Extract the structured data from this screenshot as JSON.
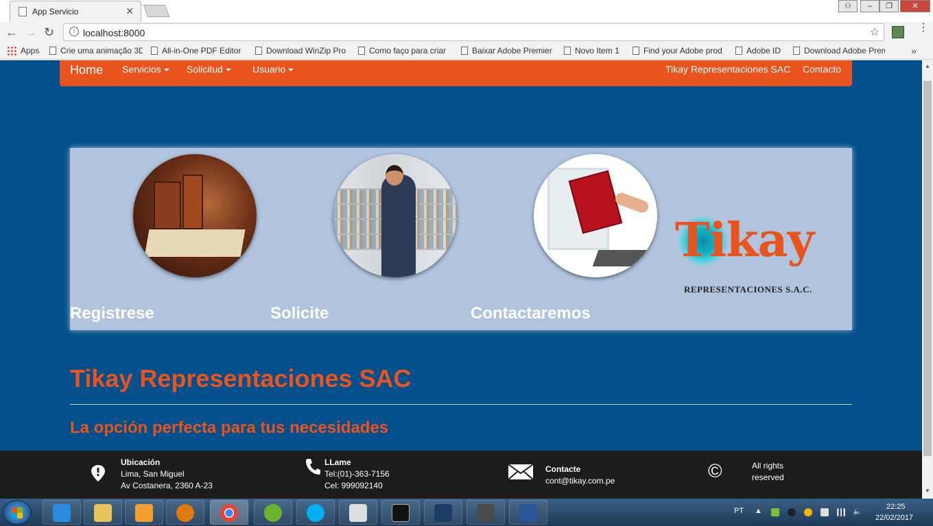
{
  "browser": {
    "tab_title": "App Servicio",
    "url": "localhost:8000",
    "bookmarks": [
      "Apps",
      "Crie uma animação 3D",
      "All-in-One PDF Editor",
      "Download WinZip Pro",
      "Como faço para criar",
      "Baixar Adobe Premier",
      "Novo Item 1",
      "Find your Adobe prod",
      "Adobe ID",
      "Download Adobe Prem"
    ]
  },
  "navbar": {
    "brand": "Home",
    "items": [
      "Servicios",
      "Solicitud",
      "Usuario"
    ],
    "right_items": [
      "Tikay Representaciones SAC",
      "Contacto"
    ]
  },
  "banner": {
    "captions": [
      "Registrese",
      "Solicite",
      "Contactaremos"
    ],
    "logo_word": "Tikay",
    "logo_sub": "REPRESENTACIONES S.A.C."
  },
  "main": {
    "heading": "Tikay Representaciones SAC",
    "subheading": "La opción perfecta para tus necesidades"
  },
  "footer": {
    "location_title": "Ubicación",
    "location_line1": "Lima, San Miguel",
    "location_line2": "Av Costanera, 2360 A-23",
    "call_title": "LLame",
    "call_line1": "Tel:(01)-363-7156",
    "call_line2": "Cel: 999092140",
    "contact_title": "Contacte",
    "contact_line1": "cont@tikay.com.pe",
    "rights_line1": "All rights",
    "rights_line2": "reserved",
    "copyright_symbol": "©"
  },
  "taskbar": {
    "language": "PT",
    "time": "22:25",
    "date": "22/02/2017"
  },
  "colors": {
    "page_bg": "#04508c",
    "accent": "#e9531d",
    "banner_bg": "#b0c4de",
    "footer_bg": "#1c1c1c"
  }
}
